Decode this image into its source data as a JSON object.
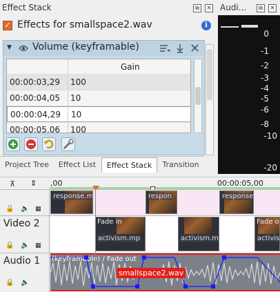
{
  "dock": {
    "title": "Effect Stack",
    "float_btn": "⧉",
    "close_btn": "✕",
    "effects_header": "Effects for smallspace2.wav",
    "effect": {
      "name": "Volume (keyframable)",
      "table": {
        "column": "Gain",
        "rows": [
          {
            "time": "00:00:03,29",
            "value": "100"
          },
          {
            "time": "00:00:04,05",
            "value": "10"
          },
          {
            "time": "00:00:04,29",
            "value": "10"
          },
          {
            "time": "00:00:05,06",
            "value": "100"
          }
        ]
      }
    },
    "tabs": [
      "Project Tree",
      "Effect List",
      "Effect Stack",
      "Transition"
    ],
    "active_tab": "Effect Stack"
  },
  "meter": {
    "title": "Audi...",
    "scale": [
      "0",
      "-1",
      "-2",
      "-3",
      "-4",
      "-5",
      "-6",
      "-8",
      "-10",
      "-20"
    ]
  },
  "timeline": {
    "ruler_start": ",00",
    "ruler_mark": "00:00:05,00",
    "tracks": [
      {
        "name": "",
        "clips": [
          "response.mp",
          "respon",
          "response"
        ]
      },
      {
        "name": "Video 2",
        "clips": [
          "Fade in",
          "activism.mp",
          "activism.mp",
          "activism.m",
          "Fade o"
        ]
      },
      {
        "name": "Audio 1",
        "clip_label": "smallspace2.wav",
        "effect_label": "(keyframable) / Fade out"
      }
    ]
  },
  "colors": {
    "accent_orange": "#e06a2a",
    "effect_bg": "#c7dbe8",
    "audio_clip_label": "#e0201b",
    "keyframe": "#1a1aff"
  }
}
